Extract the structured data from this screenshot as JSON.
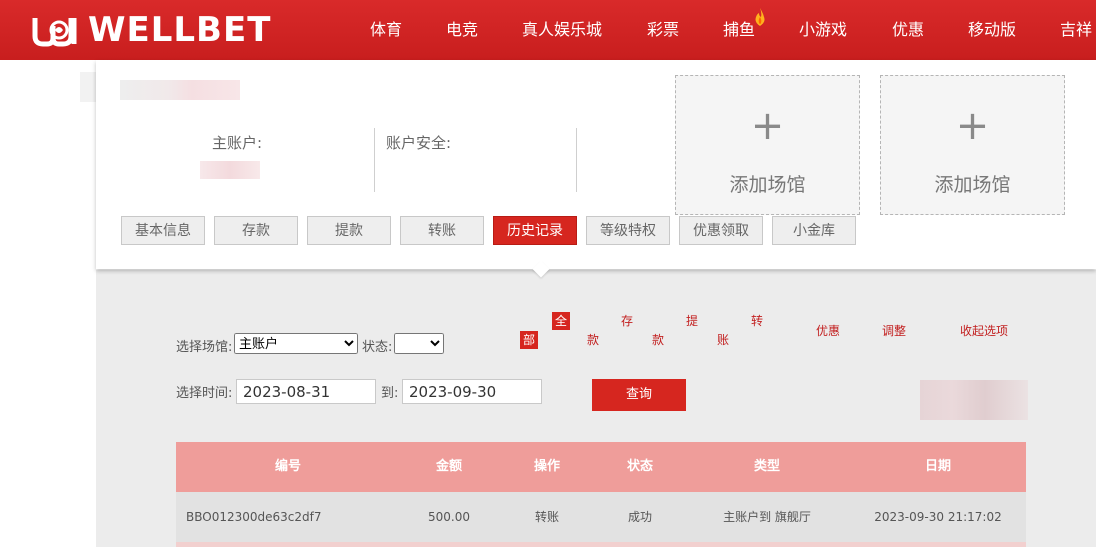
{
  "brand": {
    "name": "WELLBET",
    "color": "#d6261f"
  },
  "nav": {
    "items": [
      "体育",
      "电竞",
      "真人娱乐城",
      "彩票",
      "捕鱼",
      "小游戏",
      "优惠",
      "移动版",
      "吉祥"
    ],
    "hot_icon": "fire-icon"
  },
  "account": {
    "main_account_label": "主账户:",
    "security_label": "账户安全:"
  },
  "venues": [
    {
      "plus": "+",
      "label": "添加场馆"
    },
    {
      "plus": "+",
      "label": "添加场馆"
    }
  ],
  "tabs": [
    "基本信息",
    "存款",
    "提款",
    "转账",
    "历史记录",
    "等级特权",
    "优惠领取",
    "小金库"
  ],
  "active_tab": "历史记录",
  "filters": {
    "venue_label": "选择场馆:",
    "venue_value": "主账户",
    "status_label": "状态:",
    "status_value": "",
    "time_label": "选择时间:",
    "start_date": "2023-08-31",
    "to_label": "到:",
    "end_date": "2023-09-30",
    "query_button": "查询",
    "types": {
      "all": [
        "全",
        "部"
      ],
      "deposit": [
        "存",
        "款"
      ],
      "withdraw": [
        "提",
        "款"
      ],
      "transfer": [
        "转",
        "账"
      ],
      "promo": "优惠",
      "adjust": "调整",
      "collapse": "收起选项"
    }
  },
  "table": {
    "headers": [
      "编号",
      "金额",
      "操作",
      "状态",
      "类型",
      "日期"
    ],
    "rows": [
      [
        "BBO012300de63c2df7",
        "500.00",
        "转账",
        "成功",
        "主账户到 旗舰厅",
        "2023-09-30 21:17:02"
      ]
    ]
  }
}
